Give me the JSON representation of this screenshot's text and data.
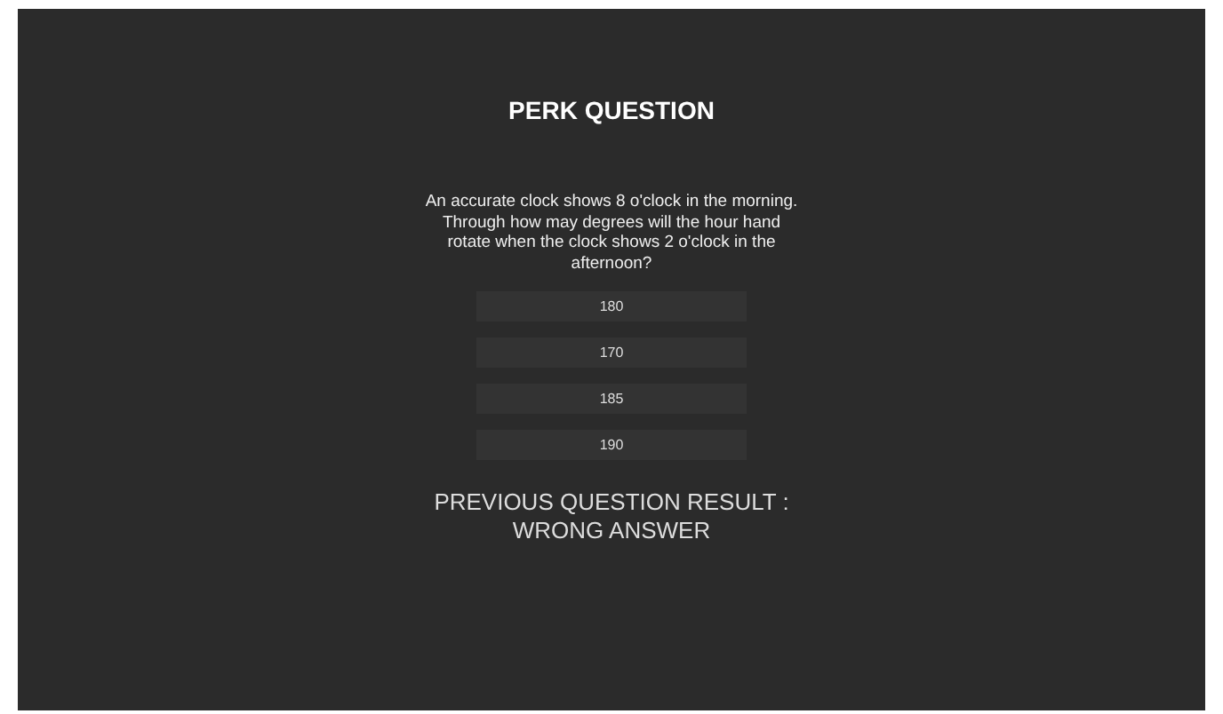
{
  "title": "PERK QUESTION",
  "question": "An accurate clock shows 8 o'clock in the morning. Through how may degrees will the hour hand rotate when the clock shows 2 o'clock in the afternoon?",
  "answers": [
    {
      "label": "180"
    },
    {
      "label": "170"
    },
    {
      "label": "185"
    },
    {
      "label": "190"
    }
  ],
  "result": {
    "label": "PREVIOUS QUESTION RESULT :",
    "value": "WRONG ANSWER"
  }
}
